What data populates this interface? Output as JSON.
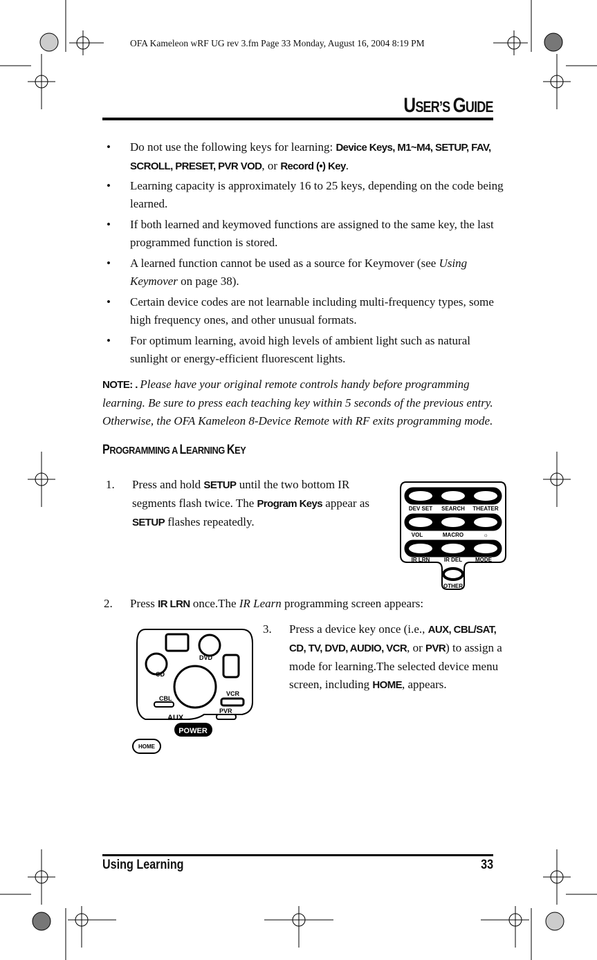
{
  "print_line": "OFA Kameleon wRF UG rev 3.fm  Page 33  Monday, August 16, 2004  8:19 PM",
  "header": {
    "title_big1": "U",
    "title_small1": "SER’S ",
    "title_big2": "G",
    "title_small2": "UIDE"
  },
  "bullets": [
    [
      {
        "t": "Do not use the following keys for learning: ",
        "s": ""
      },
      {
        "t": "Device Keys, M1~M4, SETUP, FAV, SCROLL, PRESET, PVR VOD",
        "s": "b"
      },
      {
        "t": ", or ",
        "s": ""
      },
      {
        "t": "Record (•) Key",
        "s": "b"
      },
      {
        "t": ".",
        "s": ""
      }
    ],
    [
      {
        "t": "Learning capacity is approximately 16 to 25 keys, depending on the code being learned.",
        "s": ""
      }
    ],
    [
      {
        "t": "If both learned and keymoved functions are assigned to the same key, the last programmed function is stored.",
        "s": ""
      }
    ],
    [
      {
        "t": "A learned function cannot be used as a source for Keymover (see ",
        "s": ""
      },
      {
        "t": "Using Keymover",
        "s": "i"
      },
      {
        "t": " on page 38).",
        "s": ""
      }
    ],
    [
      {
        "t": "Certain device codes are not learnable including multi-frequency types, some high frequency ones, and other unusual formats.",
        "s": ""
      }
    ],
    [
      {
        "t": "For optimum learning, avoid high levels of ambient light such as natural sunlight or energy-efficient fluorescent lights.",
        "s": ""
      }
    ]
  ],
  "note": [
    {
      "t": "NOTE: . ",
      "s": "b"
    },
    {
      "t": "Please have your original remote controls handy before programming learning. Be sure to press each teaching key within 5 seconds of the previous entry. Otherwise, the OFA Kameleon 8-Device Remote with RF exits programming mode.",
      "s": "i"
    }
  ],
  "section": {
    "big1": "P",
    "small1": "ROGRAMMING A ",
    "big2": "L",
    "small2": "EARNING ",
    "big3": "K",
    "small3": "EY"
  },
  "steps": [
    {
      "num": "1.",
      "text": [
        {
          "t": "Press and hold ",
          "s": ""
        },
        {
          "t": "SETUP",
          "s": "b"
        },
        {
          "t": " until the two bottom IR segments flash twice. The ",
          "s": ""
        },
        {
          "t": "Program Keys",
          "s": "b"
        },
        {
          "t": " appear as ",
          "s": ""
        },
        {
          "t": "SETUP",
          "s": "b"
        },
        {
          "t": " flashes repeatedly.",
          "s": ""
        }
      ]
    },
    {
      "num": "2.",
      "text": [
        {
          "t": "Press ",
          "s": ""
        },
        {
          "t": "IR LRN",
          "s": "b"
        },
        {
          "t": " once.The ",
          "s": ""
        },
        {
          "t": "IR Learn",
          "s": "i"
        },
        {
          "t": " programming screen appears:",
          "s": ""
        }
      ]
    },
    {
      "num": "3.",
      "text": [
        {
          "t": "Press a device key once (i.e., ",
          "s": ""
        },
        {
          "t": "AUX, CBL/SAT, CD, TV, DVD, AUDIO, VCR",
          "s": "b"
        },
        {
          "t": ", or ",
          "s": ""
        },
        {
          "t": "PVR",
          "s": "b"
        },
        {
          "t": ") to assign a mode for learning.The selected device menu screen, including ",
          "s": ""
        },
        {
          "t": "HOME",
          "s": "b"
        },
        {
          "t": ", appears.",
          "s": ""
        }
      ]
    }
  ],
  "program_keys": {
    "row1": [
      "DEV SET",
      "SEARCH",
      "THEATER"
    ],
    "row2": [
      "VOL",
      "MACRO"
    ],
    "row3": [
      "IR LRN",
      "IR DEL",
      "MODE"
    ],
    "other": "OTHER"
  },
  "device_screen": {
    "dvd": "DVD",
    "cd": "CD",
    "vcr": "VCR",
    "cbl": "CBL",
    "aux": "AUX",
    "pvr": "PVR",
    "power": "POWER",
    "home": "HOME"
  },
  "footer": {
    "section": "Using Learning",
    "page": "33"
  }
}
